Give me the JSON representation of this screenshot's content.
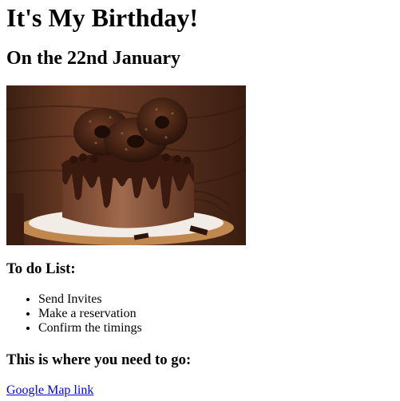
{
  "page": {
    "title": "It's My Birthday!",
    "subtitle": "On the 22nd January",
    "image": {
      "description_icon": "chocolate-cake-photo",
      "colors": {
        "background_wood": "#5a3220",
        "cake": "#7a4a33",
        "drip": "#3a1a0e",
        "plate": "#f2ece6"
      }
    },
    "todo": {
      "heading": "To do List:",
      "items": [
        "Send Invites",
        "Make a reservation",
        "Confirm the timings"
      ]
    },
    "location": {
      "heading": "This is where you need to go:",
      "link_text": "Google Map link",
      "link_color": "#0000ee"
    }
  }
}
